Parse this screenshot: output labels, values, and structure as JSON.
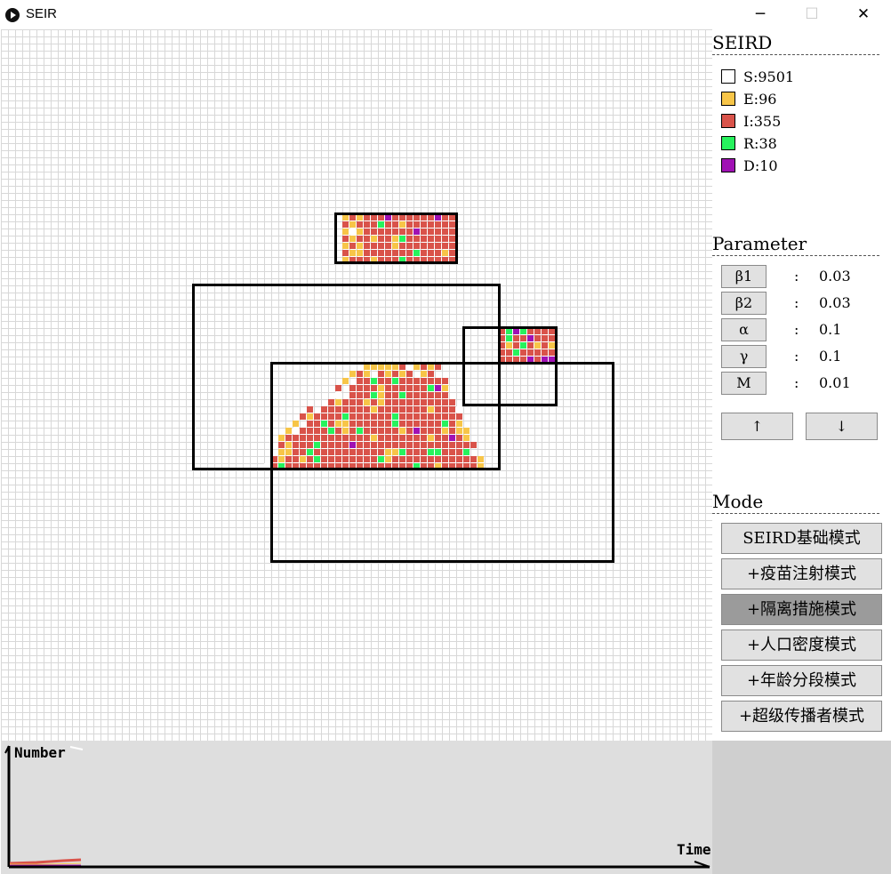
{
  "window": {
    "title": "SEIR",
    "minimize": "─",
    "maximize": "☐",
    "close": "✕"
  },
  "colors": {
    "S": "#ffffff",
    "E": "#f7c548",
    "I": "#d9534a",
    "R": "#27f25d",
    "D": "#a011b4",
    "active_mode": "#9b9b9b"
  },
  "seird": {
    "title": "SEIRD",
    "items": [
      {
        "key": "S",
        "label": "S:9501"
      },
      {
        "key": "E",
        "label": "E:96"
      },
      {
        "key": "I",
        "label": "I:355"
      },
      {
        "key": "R",
        "label": "R:38"
      },
      {
        "key": "D",
        "label": "D:10"
      }
    ]
  },
  "parameter": {
    "title": "Parameter",
    "items": [
      {
        "name": "β1",
        "sep": ":",
        "value": "0.03"
      },
      {
        "name": "β2",
        "sep": ":",
        "value": "0.03"
      },
      {
        "name": "α",
        "sep": ":",
        "value": "0.1"
      },
      {
        "name": "γ",
        "sep": ":",
        "value": "0.1"
      },
      {
        "name": "M",
        "sep": ":",
        "value": "0.01"
      }
    ],
    "up_label": "↑",
    "down_label": "↓"
  },
  "mode": {
    "title": "Mode",
    "buttons": [
      {
        "label": "SEIRD基础模式",
        "active": false
      },
      {
        "label": "+疫苗注射模式",
        "active": false
      },
      {
        "label": "+隔离措施模式",
        "active": true
      },
      {
        "label": "+人口密度模式",
        "active": false
      },
      {
        "label": "+年龄分段模式",
        "active": false
      },
      {
        "label": "+超级传播者模式",
        "active": false
      }
    ]
  },
  "chart": {
    "ylabel": "Number",
    "xlabel": "Time"
  }
}
